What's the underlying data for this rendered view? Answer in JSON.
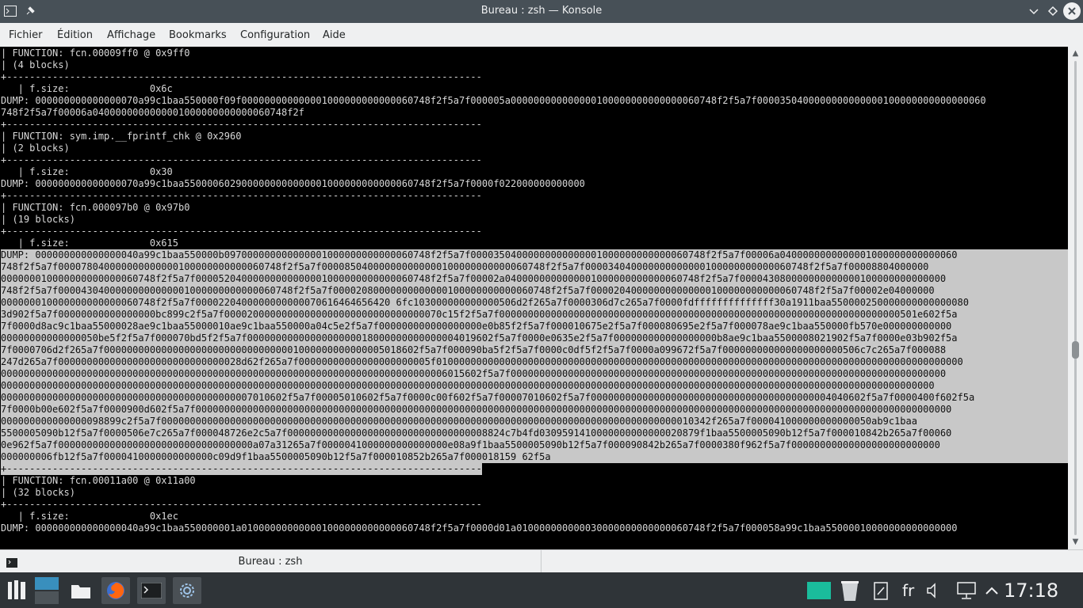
{
  "window": {
    "title": "Bureau : zsh — Konsole"
  },
  "menu": [
    "Fichier",
    "Édition",
    "Affichage",
    "Bookmarks",
    "Configuration",
    "Aide"
  ],
  "terminal": {
    "lines": [
      "| FUNCTION: fcn.00009ff0 @ 0x9ff0",
      "| (4 blocks)",
      "+-----------------------------------------------------------------------------------",
      "   | f.size:              0x6c",
      "DUMP: 000000000000000070a99c1baa550000f09f000000000000001000000000000060748f2f5a7f000005a000000000000000100000000000000060748f2f5a7f0000350400000000000000100000000000000060",
      "748f2f5a7f00006a0400000000000001000000000000060748f2f",
      "+-----------------------------------------------------------------------------------",
      "| FUNCTION: sym.imp.__fprintf_chk @ 0x2960",
      "| (2 blocks)",
      "+-----------------------------------------------------------------------------------",
      "   | f.size:              0x30",
      "DUMP: 000000000000000070a99c1baa5500006029000000000000001000000000000060748f2f5a7f0000f022000000000000",
      "+-----------------------------------------------------------------------------------",
      "| FUNCTION: fcn.000097b0 @ 0x97b0",
      "| (19 blocks)",
      "+-----------------------------------------------------------------------------------",
      "   | f.size:              0x615",
      "DUMP: 000000000000000040a99c1baa550000b097000000000000001000000000000060748f2f5a7f00003504000000000000001000000000000060748f2f5a7f00006a0400000000000001000000000000060",
      "748f2f5a7f000078040000000000000100000000000060748f2f5a7f000085040000000000000100000000000060748f2f5a7f000034040000000000000100000000000060748f2f5a7f00008804000000",
      "000000010000000000000060748f2f5a7f00005204000000000000001000000000000060748f2f5a7f00002a0400000000000001000000000000060748f2f5a7f000043080000000000000100000000000000",
      "748f2f5a7f00004304000000000000001000000000000060748f2f5a7f00002080000000000000100000000000060748f2f5a7f000020400000000000000100000000000060748f2f5a7f00002e04000000",
      "000000010000000000000060748f2f5a7f0000220400000000000070616464656420 6fc103000000000000506d2f265a7f0000306d7c265a7f0000fdffffffffffffff30a1911baa550000250000000000000080",
      "3d902f5a7f00000000000000000bc899c2f5a7f00002000000000000000000000000000000070c15f2f5a7f0000000000000000000000000000000000000000000000000000000000000000000000501e602f5a",
      "7f0000d8ac9c1baa55000028ae9c1baa55000010ae9c1baa550000a04c5e2f5a7f000000000000000000e0b85f2f5a7f000010675e2f5a7f000080695e2f5a7f000078ae9c1baa550000fb570e000000000000",
      "00000000000000050be5f2f5a7f000070bd5f2f5a7f0000000000000000000018000000000000004019602f5a7f0000e0635e2f5a7f000000000000000000b8ae9c1baa5500008021902f5a7f0000e03b902f5a",
      "7f0000706d2f265a7f0000000000000000000000000000000001000000000000005018602f5a7f000090ba5f2f5a7f0000c0df5f2f5a7f0000a099672f5a7f000000000000000000000506c7c265a7f000088",
      "247d265a7f00000000000000000000000000000028d62f265a7f00000000000000000000005f01000000000000000000000000000000000000000000000000000000000000000000000000000000000000000000",
      "000000000000000000000000000000000000000000000000000000000000000000000000000006015602f5a7f0000000000000000000000000000000000000000000000000000000000000000000000000000",
      "0000000000000000000000000000000000000000000000000000000000000000000000000000000000000000000000000000000000000000000000000000000000000000000000000000000000000000000",
      "00000000000000000000000000000000000000000007010602f5a7f00005010602f5a7f0000c00f602f5a7f00007010602f5a7f000000000000000000000000000000000000000004040602f5a7f0000400f602f5a",
      "7f0000b00e602f5a7f0000900d602f5a7f000000000000000000000000000000000000000000000000000000000000000000000000000000000000000000000000000000000000000000000000000000000000",
      "000000000000000098899c2f5a7f000000000000000000000000000000000000000000000000000000000000000000000000000000000000000000010342f265a7f000041000000000000050ab9c1baa",
      "5500005090b12f5a7f0000506e7c265a7f000048726e2c5a7f00000000000000000000000000000000008824c7b4fd0309591410000000000000020879f1baa5500005090b12f5a7f000010842b265a7f00060",
      "0e962f5a7f0000000000000000000000000000000000a07a31265a7f0000041000000000000000e08a9f1baa5500005090b12f5a7f000090842b265a7f0000380f962f5a7f00000000000000000000000000",
      "000000006fb12f5a7f0000410000000000000c09d9f1baa5500005090b12f5a7f000010852b265a7f000018159 62f5a",
      "+-----------------------------------------------------------------------------------",
      "| FUNCTION: fcn.00011a00 @ 0x11a00",
      "| (32 blocks)",
      "+-----------------------------------------------------------------------------------",
      "   | f.size:              0x1ec",
      "DUMP: 000000000000000040a99c1baa550000001a010000000000001000000000000060748f2f5a7f0000d01a010000000000030000000000000060748f2f5a7f000058a99c1baa55000010000000000000000"
    ]
  },
  "tab": {
    "label": "Bureau : zsh"
  },
  "taskbar": {
    "language": "fr",
    "clock": "17:18"
  }
}
